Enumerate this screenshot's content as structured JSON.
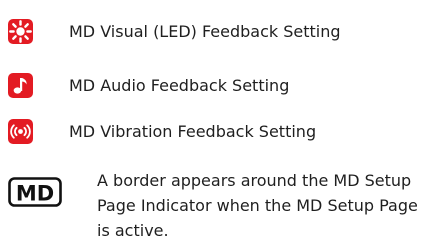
{
  "colors": {
    "icon_background": "#e31b23",
    "icon_foreground": "#ffffff",
    "text": "#1f1f1f"
  },
  "legend": {
    "items": [
      {
        "icon": "led-icon",
        "label": "MD Visual (LED) Feedback Setting"
      },
      {
        "icon": "music-note-icon",
        "label": "MD Audio Feedback Setting"
      },
      {
        "icon": "vibration-icon",
        "label": "MD Vibration Feedback Setting"
      }
    ],
    "md_indicator": {
      "icon": "md-setup-page-indicator-icon",
      "icon_text": "MD",
      "description": "A border appears around the MD Setup Page Indicator when the MD Setup Page is active."
    }
  }
}
